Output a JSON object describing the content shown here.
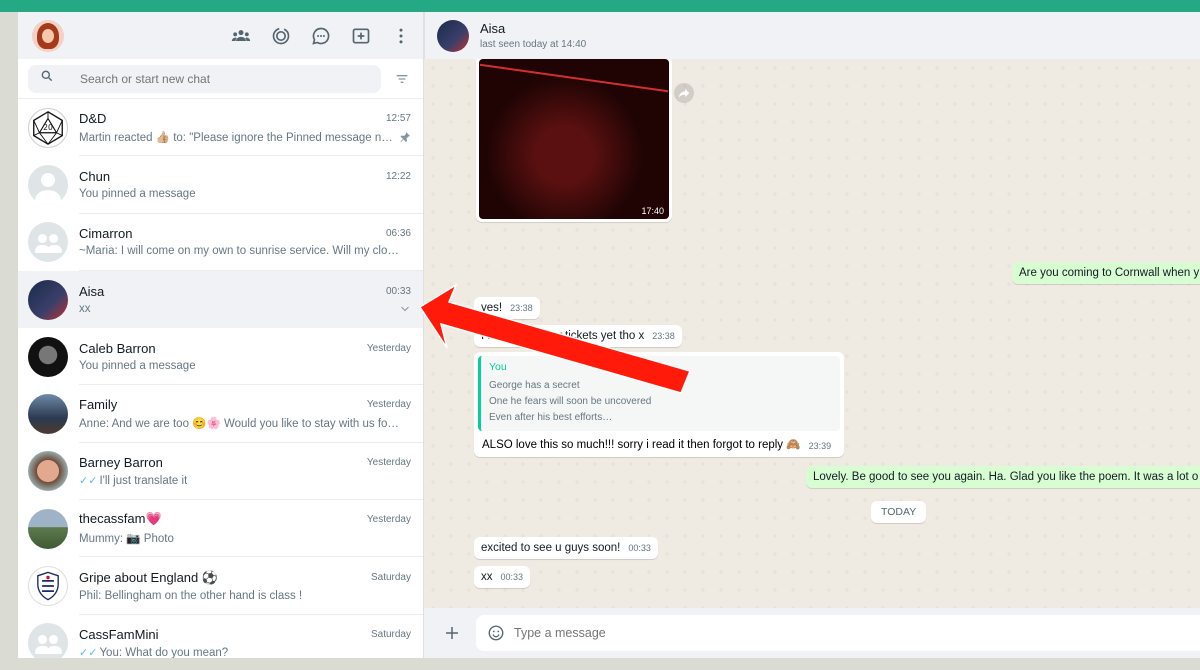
{
  "colors": {
    "brand": "#25a884",
    "accent": "#06cf9c",
    "read_ticks": "#53bdeb",
    "outgoing_bubble": "#d9fdd3",
    "arrow": "#ff1a0a"
  },
  "sidebar": {
    "search_placeholder": "Search or start new chat",
    "header_icons": [
      "communities-icon",
      "status-icon",
      "channels-icon",
      "new-chat-icon",
      "menu-dots-icon"
    ],
    "chats": [
      {
        "name": "D&D",
        "time": "12:57",
        "preview": "Martin reacted 👍🏼 to: \"Please ignore the Pinned message n…",
        "badge": "pin-icon",
        "avatar": "d20-icon"
      },
      {
        "name": "Chun",
        "time": "12:22",
        "preview": "You pinned a message",
        "avatar": "default-avatar"
      },
      {
        "name": "Cimarron",
        "time": "06:36",
        "preview": "~Maria: I will come on my own to sunrise service. Will my cloc…",
        "avatar": "group-avatar"
      },
      {
        "name": "Aisa",
        "time": "00:33",
        "preview": "xx",
        "badge": "chevron-down-icon",
        "active": true,
        "avatar": "photo"
      },
      {
        "name": "Caleb Barron",
        "time": "Yesterday",
        "preview": "You pinned a message",
        "avatar": "photo"
      },
      {
        "name": "Family",
        "time": "Yesterday",
        "preview": "Anne: And we are too 😊🌸 Would you like to stay with us for…",
        "avatar": "photo"
      },
      {
        "name": "Barney Barron",
        "time": "Yesterday",
        "preview": "I'll just translate it",
        "ticks": "✓✓",
        "avatar": "photo"
      },
      {
        "name": "thecassfam💗",
        "time": "Yesterday",
        "preview": "Mummy: 📷 Photo",
        "avatar": "photo"
      },
      {
        "name": "Gripe about England ⚽",
        "time": "Saturday",
        "preview": "Phil: Bellingham on the other hand is class !",
        "avatar": "england-crest"
      },
      {
        "name": "CassFamMini",
        "time": "Saturday",
        "preview": "You: What do you mean?",
        "ticks": "✓✓",
        "avatar": "group-avatar"
      }
    ]
  },
  "conversation": {
    "contact_name": "Aisa",
    "contact_status": "last seen today at 14:40",
    "video_time": "17:40",
    "messages": {
      "m1": {
        "text": "Are you coming to Cornwall when y"
      },
      "m2": {
        "text": "yes!",
        "time": "23:38"
      },
      "m3": {
        "text": "I haven't got my tickets yet tho x",
        "time": "23:38"
      },
      "quote": {
        "author": "You",
        "lines": [
          "George has a secret",
          "One he fears will soon be uncovered",
          "Even after his best efforts…"
        ],
        "text": "ALSO love this so much!!! sorry i read it then forgot to reply 🙈",
        "time": "23:39"
      },
      "m4": {
        "text": "Lovely. Be good to see you again. Ha. Glad you like the poem. It was a lot o"
      },
      "date_chip": "TODAY",
      "m5": {
        "text": "excited to see u guys soon!",
        "time": "00:33"
      },
      "m6": {
        "text": "xx",
        "time": "00:33"
      }
    },
    "composer_placeholder": "Type a message"
  }
}
